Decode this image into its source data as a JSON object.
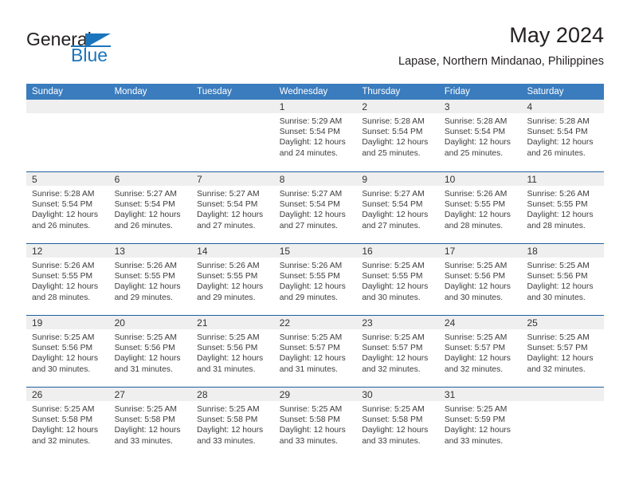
{
  "logo": {
    "text_primary": "General",
    "text_secondary": "Blue",
    "icon": "triangle-flag-icon"
  },
  "header": {
    "title": "May 2024",
    "subtitle": "Lapase, Northern Mindanao, Philippines"
  },
  "colors": {
    "header_blue": "#3a7cbe",
    "separator_blue": "#1f5fa0",
    "day_band_gray": "#efefef",
    "brand_blue": "#1b75bc",
    "text_dark": "#231f20"
  },
  "weekdays": [
    "Sunday",
    "Monday",
    "Tuesday",
    "Wednesday",
    "Thursday",
    "Friday",
    "Saturday"
  ],
  "weeks": [
    [
      {
        "day": "",
        "sunrise": "",
        "sunset": "",
        "daylight1": "",
        "daylight2": "",
        "empty": true
      },
      {
        "day": "",
        "sunrise": "",
        "sunset": "",
        "daylight1": "",
        "daylight2": "",
        "empty": true
      },
      {
        "day": "",
        "sunrise": "",
        "sunset": "",
        "daylight1": "",
        "daylight2": "",
        "empty": true
      },
      {
        "day": "1",
        "sunrise": "Sunrise: 5:29 AM",
        "sunset": "Sunset: 5:54 PM",
        "daylight1": "Daylight: 12 hours",
        "daylight2": "and 24 minutes."
      },
      {
        "day": "2",
        "sunrise": "Sunrise: 5:28 AM",
        "sunset": "Sunset: 5:54 PM",
        "daylight1": "Daylight: 12 hours",
        "daylight2": "and 25 minutes."
      },
      {
        "day": "3",
        "sunrise": "Sunrise: 5:28 AM",
        "sunset": "Sunset: 5:54 PM",
        "daylight1": "Daylight: 12 hours",
        "daylight2": "and 25 minutes."
      },
      {
        "day": "4",
        "sunrise": "Sunrise: 5:28 AM",
        "sunset": "Sunset: 5:54 PM",
        "daylight1": "Daylight: 12 hours",
        "daylight2": "and 26 minutes."
      }
    ],
    [
      {
        "day": "5",
        "sunrise": "Sunrise: 5:28 AM",
        "sunset": "Sunset: 5:54 PM",
        "daylight1": "Daylight: 12 hours",
        "daylight2": "and 26 minutes."
      },
      {
        "day": "6",
        "sunrise": "Sunrise: 5:27 AM",
        "sunset": "Sunset: 5:54 PM",
        "daylight1": "Daylight: 12 hours",
        "daylight2": "and 26 minutes."
      },
      {
        "day": "7",
        "sunrise": "Sunrise: 5:27 AM",
        "sunset": "Sunset: 5:54 PM",
        "daylight1": "Daylight: 12 hours",
        "daylight2": "and 27 minutes."
      },
      {
        "day": "8",
        "sunrise": "Sunrise: 5:27 AM",
        "sunset": "Sunset: 5:54 PM",
        "daylight1": "Daylight: 12 hours",
        "daylight2": "and 27 minutes."
      },
      {
        "day": "9",
        "sunrise": "Sunrise: 5:27 AM",
        "sunset": "Sunset: 5:54 PM",
        "daylight1": "Daylight: 12 hours",
        "daylight2": "and 27 minutes."
      },
      {
        "day": "10",
        "sunrise": "Sunrise: 5:26 AM",
        "sunset": "Sunset: 5:55 PM",
        "daylight1": "Daylight: 12 hours",
        "daylight2": "and 28 minutes."
      },
      {
        "day": "11",
        "sunrise": "Sunrise: 5:26 AM",
        "sunset": "Sunset: 5:55 PM",
        "daylight1": "Daylight: 12 hours",
        "daylight2": "and 28 minutes."
      }
    ],
    [
      {
        "day": "12",
        "sunrise": "Sunrise: 5:26 AM",
        "sunset": "Sunset: 5:55 PM",
        "daylight1": "Daylight: 12 hours",
        "daylight2": "and 28 minutes."
      },
      {
        "day": "13",
        "sunrise": "Sunrise: 5:26 AM",
        "sunset": "Sunset: 5:55 PM",
        "daylight1": "Daylight: 12 hours",
        "daylight2": "and 29 minutes."
      },
      {
        "day": "14",
        "sunrise": "Sunrise: 5:26 AM",
        "sunset": "Sunset: 5:55 PM",
        "daylight1": "Daylight: 12 hours",
        "daylight2": "and 29 minutes."
      },
      {
        "day": "15",
        "sunrise": "Sunrise: 5:26 AM",
        "sunset": "Sunset: 5:55 PM",
        "daylight1": "Daylight: 12 hours",
        "daylight2": "and 29 minutes."
      },
      {
        "day": "16",
        "sunrise": "Sunrise: 5:25 AM",
        "sunset": "Sunset: 5:55 PM",
        "daylight1": "Daylight: 12 hours",
        "daylight2": "and 30 minutes."
      },
      {
        "day": "17",
        "sunrise": "Sunrise: 5:25 AM",
        "sunset": "Sunset: 5:56 PM",
        "daylight1": "Daylight: 12 hours",
        "daylight2": "and 30 minutes."
      },
      {
        "day": "18",
        "sunrise": "Sunrise: 5:25 AM",
        "sunset": "Sunset: 5:56 PM",
        "daylight1": "Daylight: 12 hours",
        "daylight2": "and 30 minutes."
      }
    ],
    [
      {
        "day": "19",
        "sunrise": "Sunrise: 5:25 AM",
        "sunset": "Sunset: 5:56 PM",
        "daylight1": "Daylight: 12 hours",
        "daylight2": "and 30 minutes."
      },
      {
        "day": "20",
        "sunrise": "Sunrise: 5:25 AM",
        "sunset": "Sunset: 5:56 PM",
        "daylight1": "Daylight: 12 hours",
        "daylight2": "and 31 minutes."
      },
      {
        "day": "21",
        "sunrise": "Sunrise: 5:25 AM",
        "sunset": "Sunset: 5:56 PM",
        "daylight1": "Daylight: 12 hours",
        "daylight2": "and 31 minutes."
      },
      {
        "day": "22",
        "sunrise": "Sunrise: 5:25 AM",
        "sunset": "Sunset: 5:57 PM",
        "daylight1": "Daylight: 12 hours",
        "daylight2": "and 31 minutes."
      },
      {
        "day": "23",
        "sunrise": "Sunrise: 5:25 AM",
        "sunset": "Sunset: 5:57 PM",
        "daylight1": "Daylight: 12 hours",
        "daylight2": "and 32 minutes."
      },
      {
        "day": "24",
        "sunrise": "Sunrise: 5:25 AM",
        "sunset": "Sunset: 5:57 PM",
        "daylight1": "Daylight: 12 hours",
        "daylight2": "and 32 minutes."
      },
      {
        "day": "25",
        "sunrise": "Sunrise: 5:25 AM",
        "sunset": "Sunset: 5:57 PM",
        "daylight1": "Daylight: 12 hours",
        "daylight2": "and 32 minutes."
      }
    ],
    [
      {
        "day": "26",
        "sunrise": "Sunrise: 5:25 AM",
        "sunset": "Sunset: 5:58 PM",
        "daylight1": "Daylight: 12 hours",
        "daylight2": "and 32 minutes."
      },
      {
        "day": "27",
        "sunrise": "Sunrise: 5:25 AM",
        "sunset": "Sunset: 5:58 PM",
        "daylight1": "Daylight: 12 hours",
        "daylight2": "and 33 minutes."
      },
      {
        "day": "28",
        "sunrise": "Sunrise: 5:25 AM",
        "sunset": "Sunset: 5:58 PM",
        "daylight1": "Daylight: 12 hours",
        "daylight2": "and 33 minutes."
      },
      {
        "day": "29",
        "sunrise": "Sunrise: 5:25 AM",
        "sunset": "Sunset: 5:58 PM",
        "daylight1": "Daylight: 12 hours",
        "daylight2": "and 33 minutes."
      },
      {
        "day": "30",
        "sunrise": "Sunrise: 5:25 AM",
        "sunset": "Sunset: 5:58 PM",
        "daylight1": "Daylight: 12 hours",
        "daylight2": "and 33 minutes."
      },
      {
        "day": "31",
        "sunrise": "Sunrise: 5:25 AM",
        "sunset": "Sunset: 5:59 PM",
        "daylight1": "Daylight: 12 hours",
        "daylight2": "and 33 minutes."
      },
      {
        "day": "",
        "sunrise": "",
        "sunset": "",
        "daylight1": "",
        "daylight2": "",
        "empty": true
      }
    ]
  ]
}
